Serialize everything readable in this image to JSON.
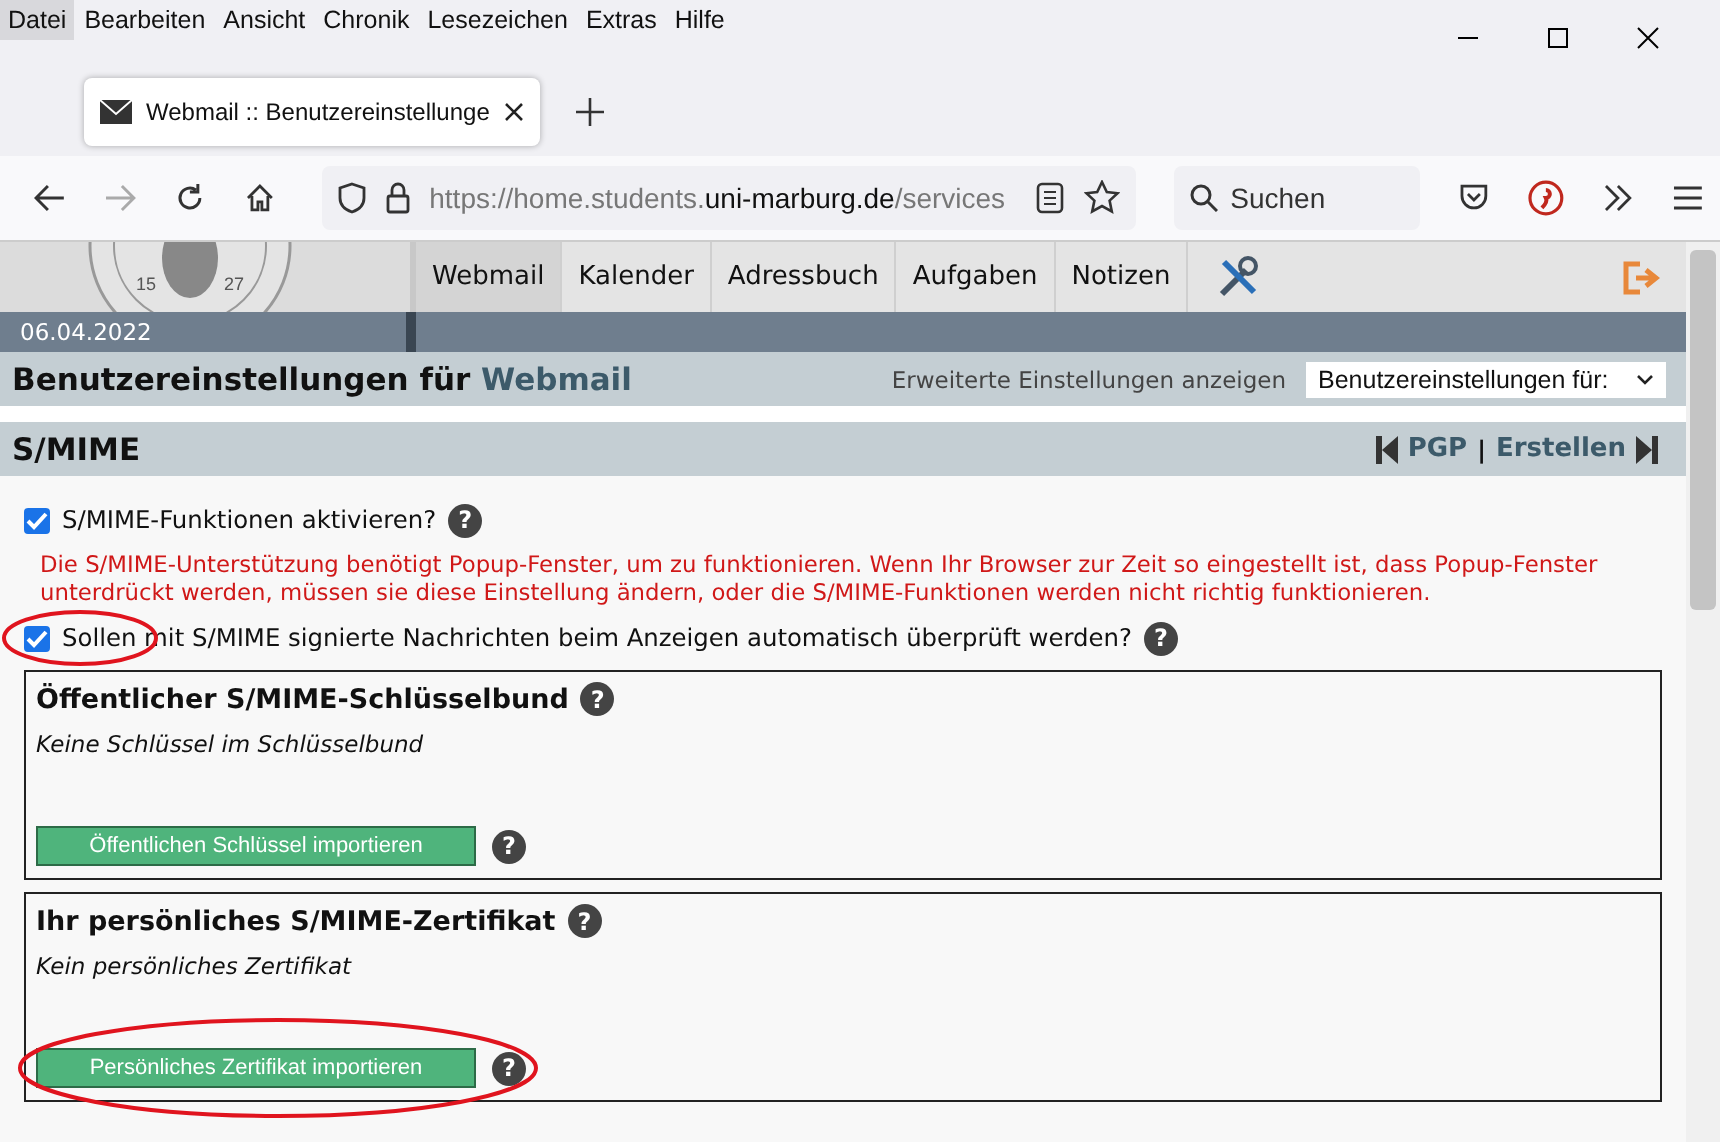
{
  "menu": [
    {
      "label": "Datei",
      "selected": true
    },
    {
      "label": "Bearbeiten",
      "selected": false
    },
    {
      "label": "Ansicht",
      "selected": false
    },
    {
      "label": "Chronik",
      "selected": false
    },
    {
      "label": "Lesezeichen",
      "selected": false
    },
    {
      "label": "Extras",
      "selected": false
    },
    {
      "label": "Hilfe",
      "selected": false
    }
  ],
  "browser_tab": {
    "title": "Webmail :: Benutzereinstellunge"
  },
  "url": {
    "prefix": "https://home.students.",
    "domain": "uni-marburg.de",
    "path": "/services"
  },
  "search": {
    "placeholder": "Suchen"
  },
  "nav_tabs": [
    {
      "label": "Webmail",
      "selected": true
    },
    {
      "label": "Kalender",
      "selected": false
    },
    {
      "label": "Adressbuch",
      "selected": false
    },
    {
      "label": "Aufgaben",
      "selected": false
    },
    {
      "label": "Notizen",
      "selected": false
    }
  ],
  "seal": {
    "left_number": "15",
    "right_number": "27"
  },
  "date": "06.04.2022",
  "page_title": {
    "text": "Benutzereinstellungen für",
    "app": "Webmail"
  },
  "advanced_link": "Erweiterte Einstellungen anzeigen",
  "prefs_select": {
    "value": "Benutzereinstellungen für:"
  },
  "section": {
    "title": "S/MIME",
    "prev": "PGP",
    "separator": "|",
    "next": "Erstellen"
  },
  "options": [
    {
      "kind": "checkbox",
      "label": "S/MIME-Funktionen aktivieren?",
      "checked": true,
      "circled": false,
      "help": "?"
    },
    {
      "kind": "warning",
      "text": "Die S/MIME-Unterstützung benötigt Popup-Fenster, um zu funktionieren. Wenn Ihr Browser zur Zeit so eingestellt ist, dass Popup-Fenster unterdrückt werden, müssen sie diese Einstellung ändern, oder die S/MIME-Funktionen werden nicht richtig funktionieren."
    },
    {
      "kind": "checkbox",
      "label": "Sollen mit S/MIME signierte Nachrichten beim Anzeigen automatisch überprüft werden?",
      "checked": true,
      "circled": true,
      "help": "?"
    }
  ],
  "boxes": [
    {
      "title": "Öffentlicher S/MIME-Schlüsselbund",
      "note": "Keine Schlüssel im Schlüsselbund",
      "button": "Öffentlichen Schlüssel importieren",
      "circled": false,
      "title_help": "?",
      "button_help": "?"
    },
    {
      "title": "Ihr persönliches S/MIME-Zertifikat",
      "note": "Kein persönliches Zertifikat",
      "button": "Persönliches Zertifikat importieren",
      "circled": true,
      "title_help": "?",
      "button_help": "?"
    }
  ]
}
